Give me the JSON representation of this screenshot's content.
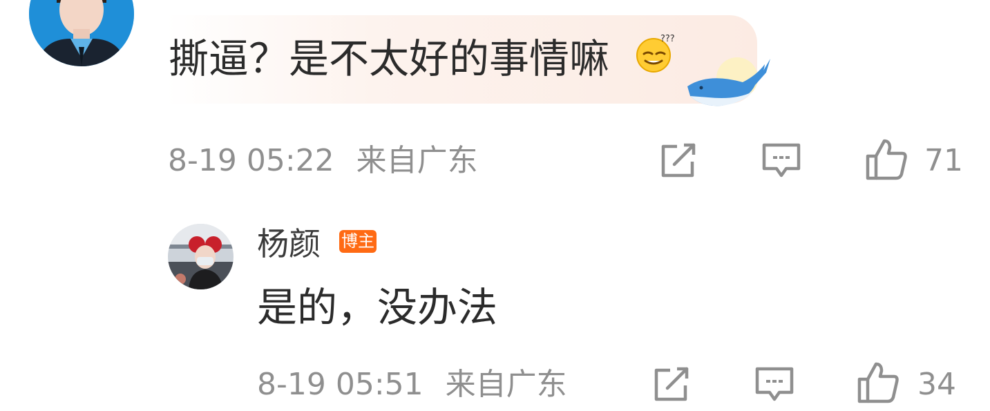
{
  "comment": {
    "text": "撕逼？是不太好的事情嘛",
    "emoji": "thinking-face-emoji",
    "timestamp": "8-19 05:22",
    "location": "来自广东",
    "likes": "71"
  },
  "reply": {
    "author": "杨颜",
    "badge": "博主",
    "text": "是的，没办法",
    "timestamp": "8-19 05:51",
    "location": "来自广东",
    "likes": "34"
  },
  "icons": {
    "share": "share-edit-icon",
    "comment": "comment-icon",
    "like": "thumbs-up-icon"
  },
  "colors": {
    "meta_text": "#8f8f8f",
    "badge_bg": "#ff6a13"
  }
}
